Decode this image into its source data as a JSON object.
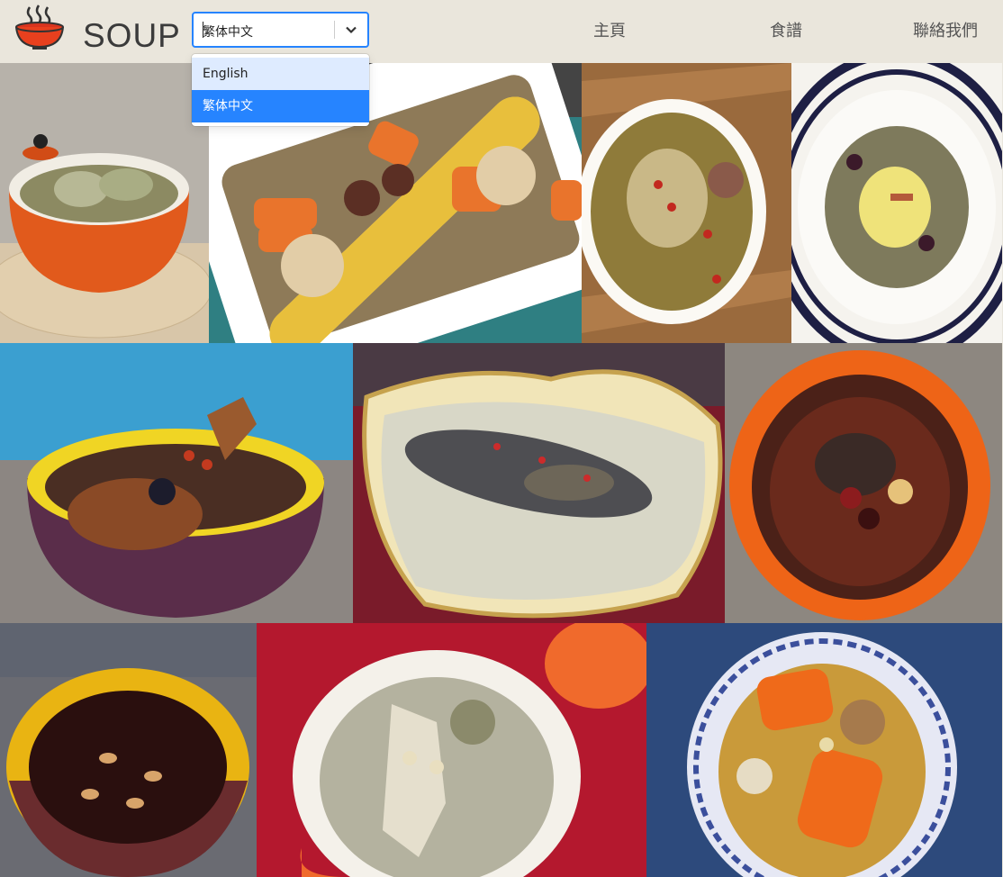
{
  "brand": {
    "name": "SOUP",
    "logo_icon": "soup-bowl-icon"
  },
  "language_select": {
    "value": "繁体中文",
    "options": [
      "English",
      "繁体中文"
    ],
    "highlighted": "English",
    "selected": "繁体中文"
  },
  "nav": {
    "home": "主頁",
    "recipes": "食譜",
    "contact": "聯絡我們"
  },
  "colors": {
    "header_bg": "#eae6dc",
    "select_focus": "#2684ff",
    "option_hover": "#deebff",
    "nav_text": "#555555"
  }
}
